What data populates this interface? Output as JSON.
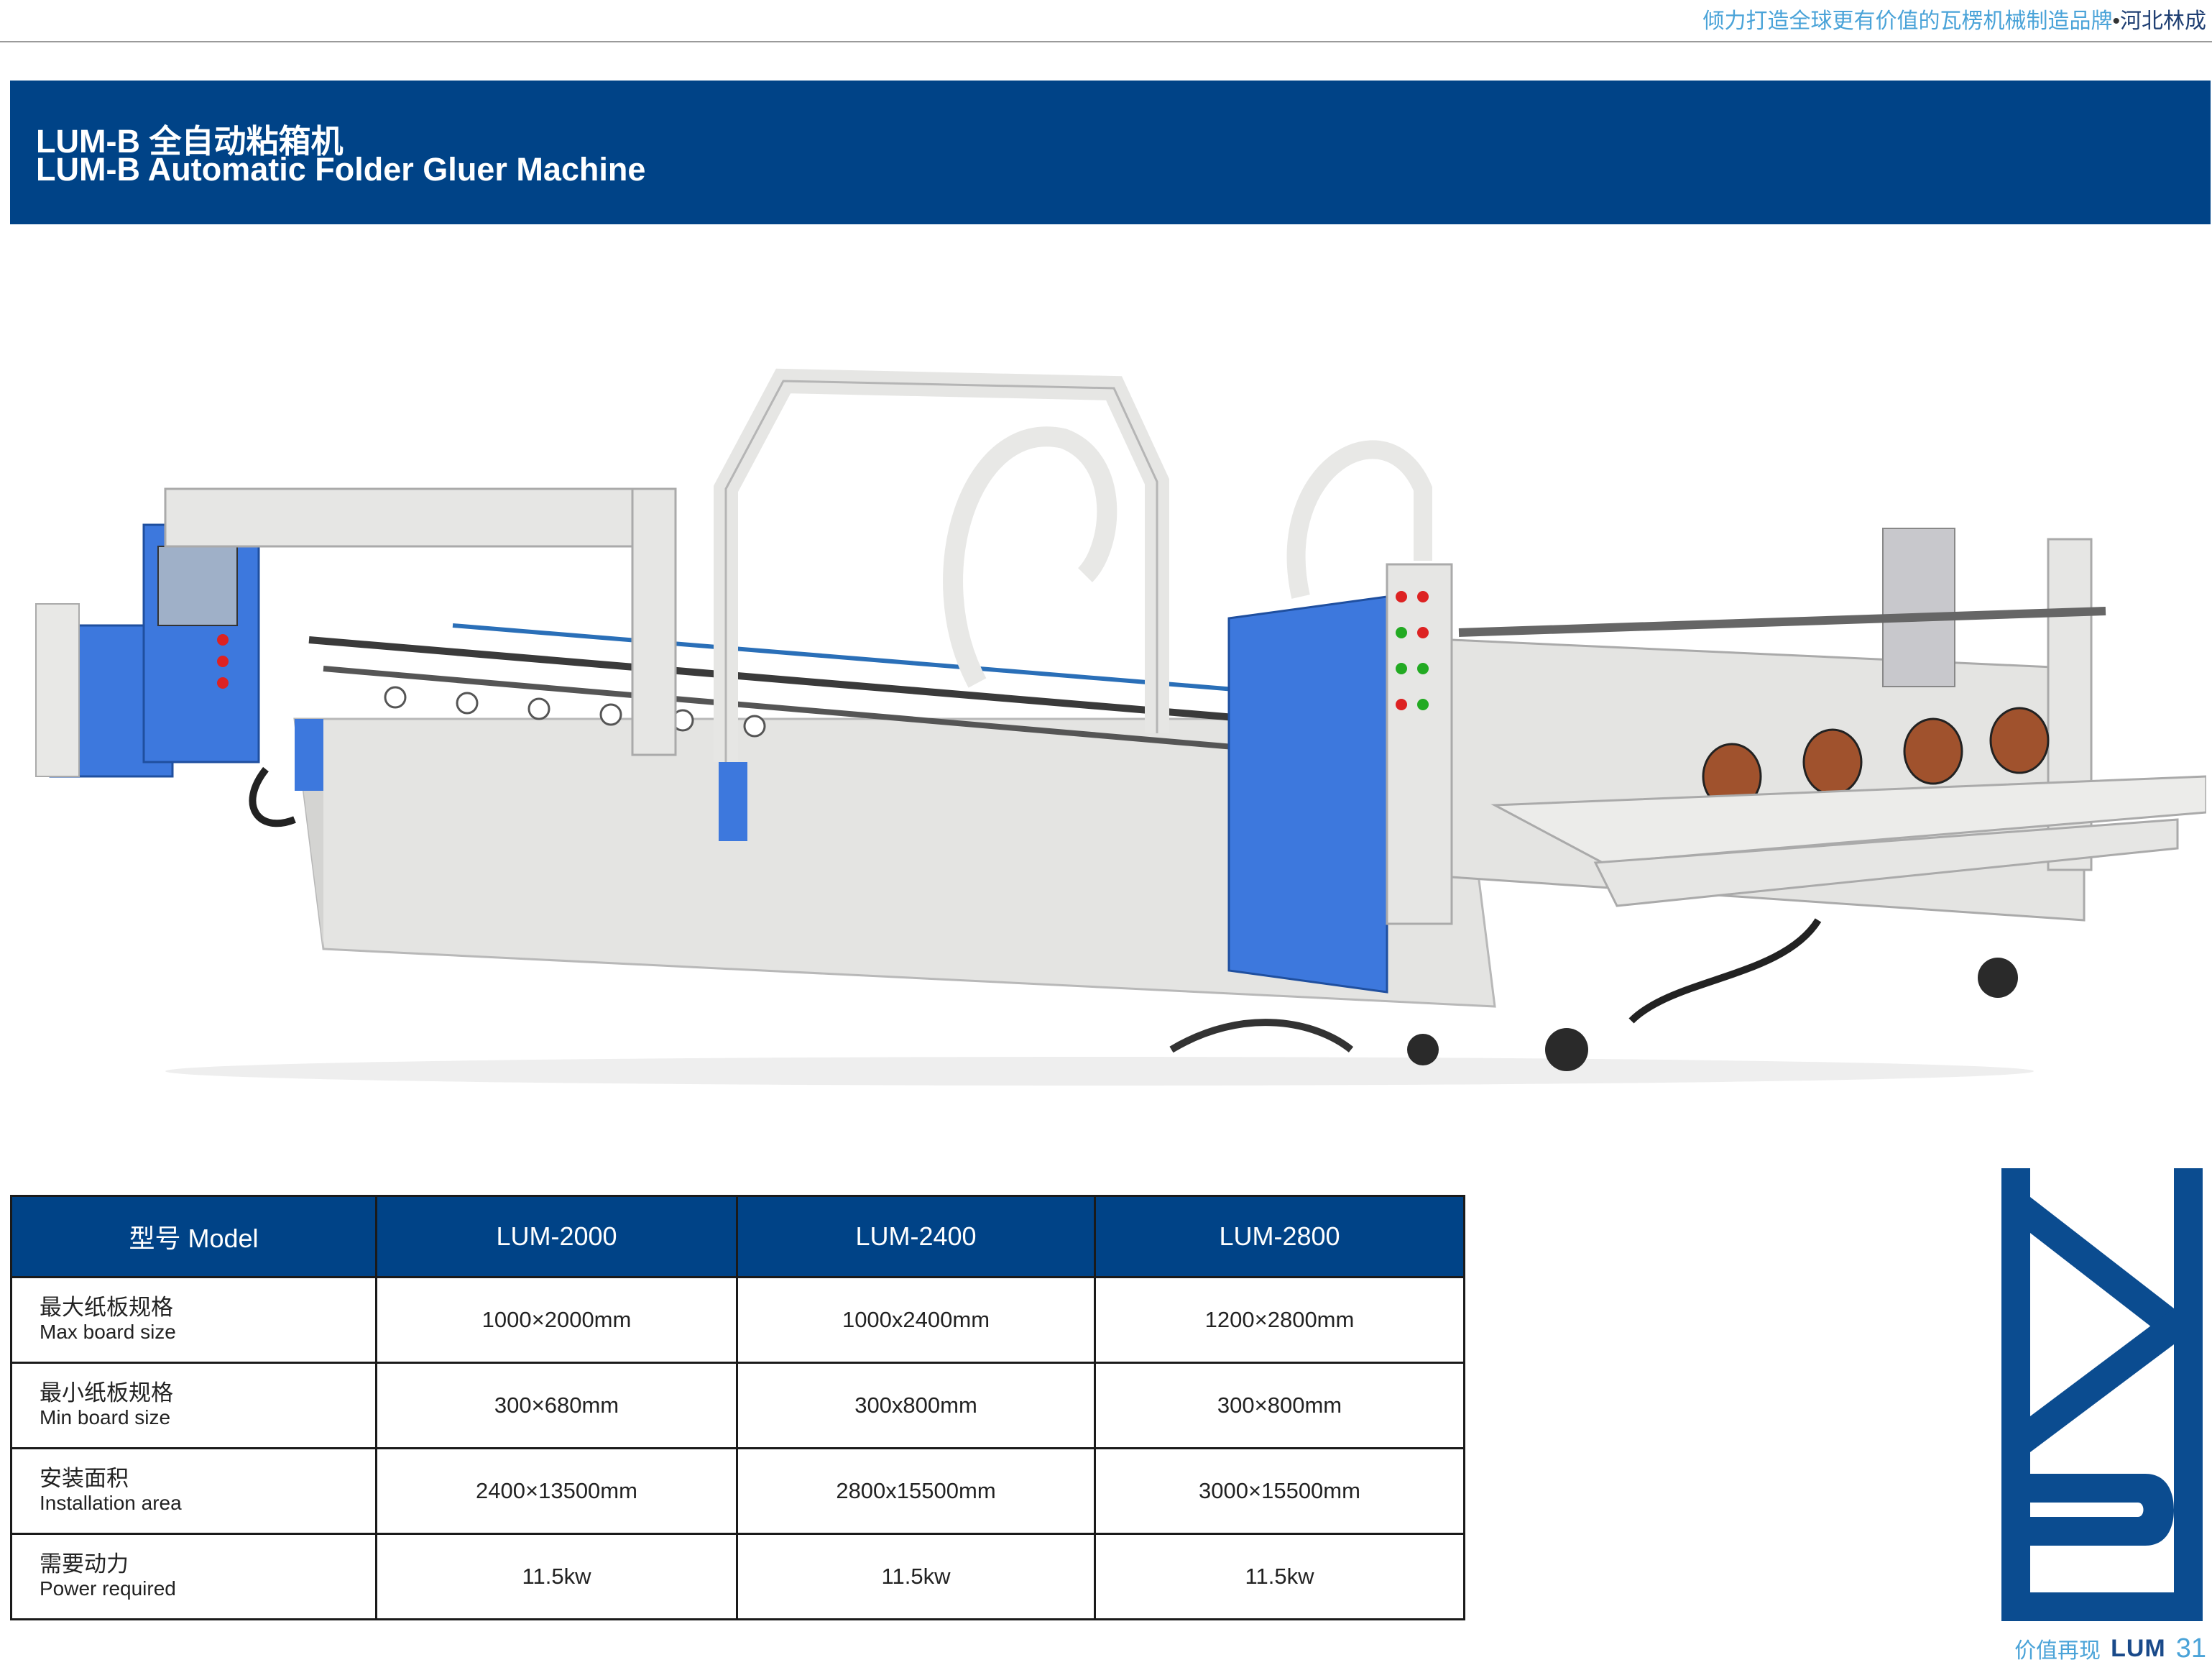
{
  "header": {
    "tagline": "倾力打造全球更有价值的瓦楞机械制造品牌",
    "dot": "•",
    "brand": "河北林成"
  },
  "title": {
    "zh": "LUM-B 全自动粘箱机",
    "en": "LUM-B Automatic Folder Gluer Machine"
  },
  "colors": {
    "banner": "#004387",
    "accent": "#4aa3d8",
    "machine_blue": "#2f6bd8",
    "machine_body": "#e8e8e6"
  },
  "specs": {
    "header": [
      "型号 Model",
      "LUM-2000",
      "LUM-2400",
      "LUM-2800"
    ],
    "rows": [
      {
        "zh": "最大纸板规格",
        "en": "Max board size",
        "values": [
          "1000×2000mm",
          "1000x2400mm",
          "1200×2800mm"
        ]
      },
      {
        "zh": "最小纸板规格",
        "en": "Min board size",
        "values": [
          "300×680mm",
          "300x800mm",
          "300×800mm"
        ]
      },
      {
        "zh": "安装面积",
        "en": "Installation area",
        "values": [
          "2400×13500mm",
          "2800x15500mm",
          "3000×15500mm"
        ]
      },
      {
        "zh": "需要动力",
        "en": "Power required",
        "values": [
          "11.5kw",
          "11.5kw",
          "11.5kw"
        ]
      }
    ]
  },
  "footer": {
    "slogan": "价值再现",
    "logo_text": "LUM",
    "page": "31"
  }
}
